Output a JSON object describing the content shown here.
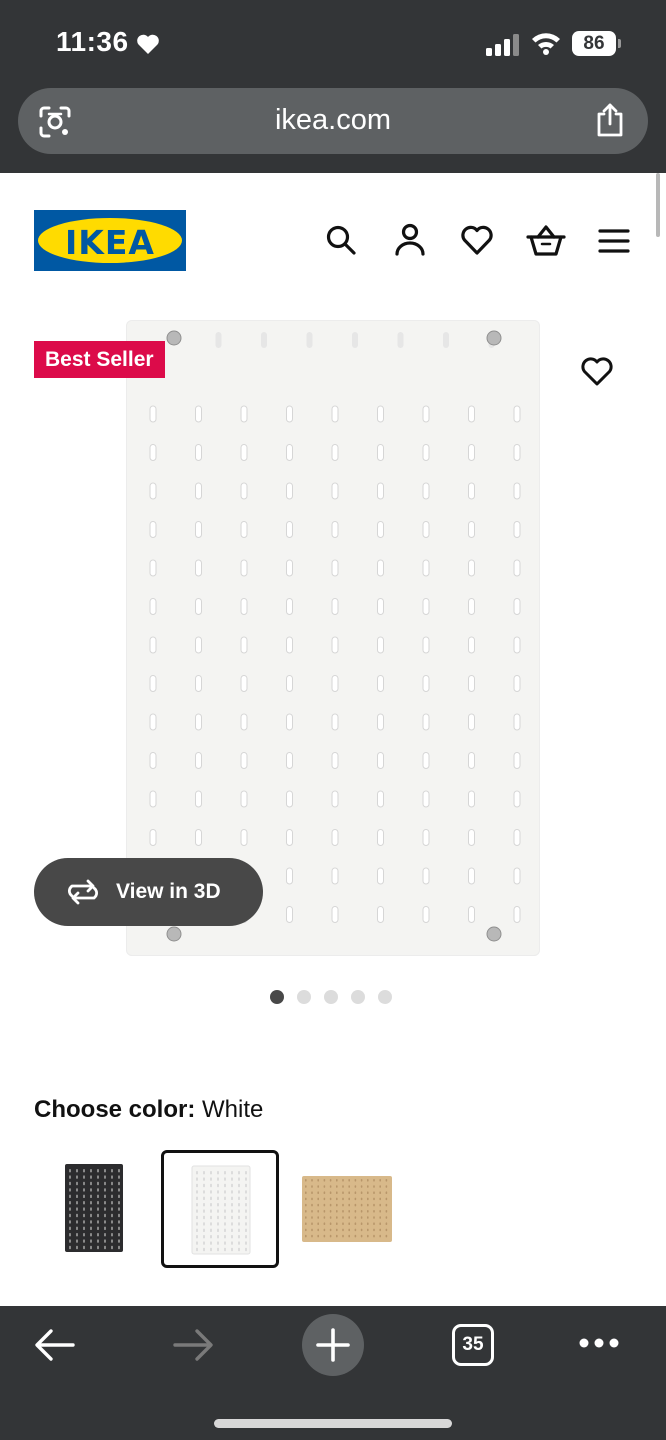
{
  "status_bar": {
    "time": "11:36",
    "battery": "86"
  },
  "url_bar": {
    "url": "ikea.com"
  },
  "header": {
    "logo_text": "IKEA"
  },
  "product": {
    "badge": "Best Seller",
    "view_3d_label": "View in 3D",
    "image_count": 5,
    "active_image_index": 0
  },
  "color_chooser": {
    "label": "Choose color:",
    "selected_value": "White",
    "options": [
      "black",
      "white",
      "wood"
    ]
  },
  "toolbar": {
    "tab_count": "35"
  },
  "colors": {
    "chrome": "#333537",
    "ikea_blue": "#0058a3",
    "ikea_yellow": "#ffdb00",
    "badge": "#dc0b4a"
  }
}
